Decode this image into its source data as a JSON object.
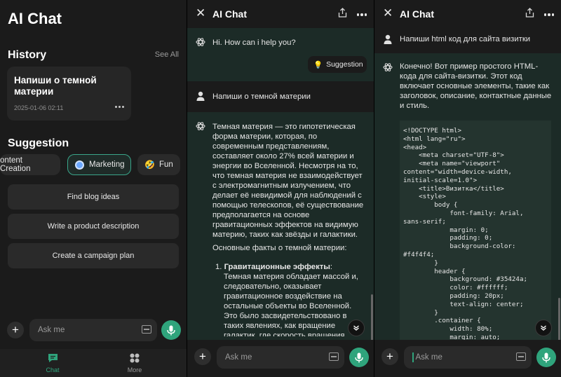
{
  "panel1": {
    "title": "AI Chat",
    "history_heading": "History",
    "see_all": "See All",
    "history_card": {
      "title": "Напиши о темной материи",
      "date": "2025-01-06 02:11"
    },
    "suggestion_heading": "Suggestion",
    "chips": [
      {
        "label": "ontent Creation",
        "icon": "content-icon"
      },
      {
        "label": "Marketing",
        "icon": "marketing-icon"
      },
      {
        "label": "Fun",
        "icon": "laugh-emoji-icon",
        "emoji": "🤣"
      }
    ],
    "suggestions": [
      "Find blog ideas",
      "Write a product description",
      "Create a campaign plan"
    ],
    "input_placeholder": "Ask me",
    "nav": [
      {
        "label": "Chat",
        "icon": "chat-icon",
        "active": true
      },
      {
        "label": "More",
        "icon": "grid-icon",
        "active": false
      }
    ]
  },
  "panel2": {
    "title": "AI Chat",
    "greeting": "Hi. How can i help you?",
    "suggestion_pill": "Suggestion",
    "suggestion_emoji": "💡",
    "user_message": "Напиши о темной материи",
    "ai_paragraph": "Темная материя — это гипотетическая форма материи, которая, по современным представлениям, составляет около 27% всей материи и энергии во Вселенной. Несмотря на то, что темная материя не взаимодействует с электромагнитным излучением, что делает её невидимой для наблюдений с помощью телескопов, её существование предполагается на основе гравитационных эффектов на видимую материю, таких как звёзды и галактики.",
    "facts_heading": "Основные факты о темной материи:",
    "fact_1_title": "Гравитационные эффекты",
    "fact_1_text": "Темная материя обладает массой и, следовательно, оказывает гравитационное воздействие на остальные объекты во Вселенной. Это было засвидетельствовано в таких явлениях, как вращение галактик, где скорость вращения",
    "input_placeholder": "Ask me"
  },
  "panel3": {
    "title": "AI Chat",
    "user_message": "Напиши html код для сайта визитки",
    "ai_intro": "Конечно! Вот пример простого HTML-кода для сайта-визитки. Этот код включает основные элементы, такие как заголовок, описание, контактные данные и стиль.",
    "code": "<!DOCTYPE html>\n<html lang=\"ru\">\n<head>\n    <meta charset=\"UTF-8\">\n    <meta name=\"viewport\"\ncontent=\"width=device-width,\ninitial-scale=1.0\">\n    <title>Визитка</title>\n    <style>\n        body {\n            font-family: Arial,\nsans-serif;\n            margin: 0;\n            padding: 0;\n            background-color:\n#f4f4f4;\n        }\n        header {\n            background: #35424a;\n            color: #ffffff;\n            padding: 20px;\n            text-align: center;\n        }\n        .container {\n            width: 80%;\n            margin: auto;",
    "input_placeholder": "Ask me"
  },
  "colors": {
    "accent": "#2fa47c",
    "ai_bubble": "#1c2b27",
    "background": "#1b1b1b"
  }
}
